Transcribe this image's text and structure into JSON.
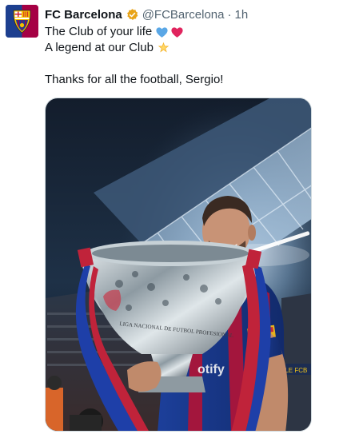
{
  "tweet": {
    "author_name": "FC Barcelona",
    "handle": "@FCBarcelona",
    "separator": "·",
    "timestamp": "1h",
    "lines": [
      "The Club of your life",
      "A legend at our Club",
      "",
      "Thanks for all the football, Sergio!"
    ],
    "emojis": {
      "line1": [
        "blue-heart-icon",
        "red-heart-icon"
      ],
      "line2": [
        "glowing-star-icon"
      ]
    },
    "verified_badge": "gold-verified-icon",
    "avatar": "fc-barcelona-crest",
    "photo_text": {
      "trophy_engraving": "LIGA NACIONAL DE FUTBOL PROFESIONAL",
      "ad_board": "ALE FCB"
    }
  },
  "colors": {
    "text_primary": "#0f1419",
    "text_secondary": "#536471",
    "verified_gold": "#e8a419",
    "blue_heart": "#5aa7e6",
    "red_heart": "#e0245e",
    "border": "#cfd9de",
    "barca_blue": "#1d3f8f",
    "barca_garnet": "#a50044"
  }
}
